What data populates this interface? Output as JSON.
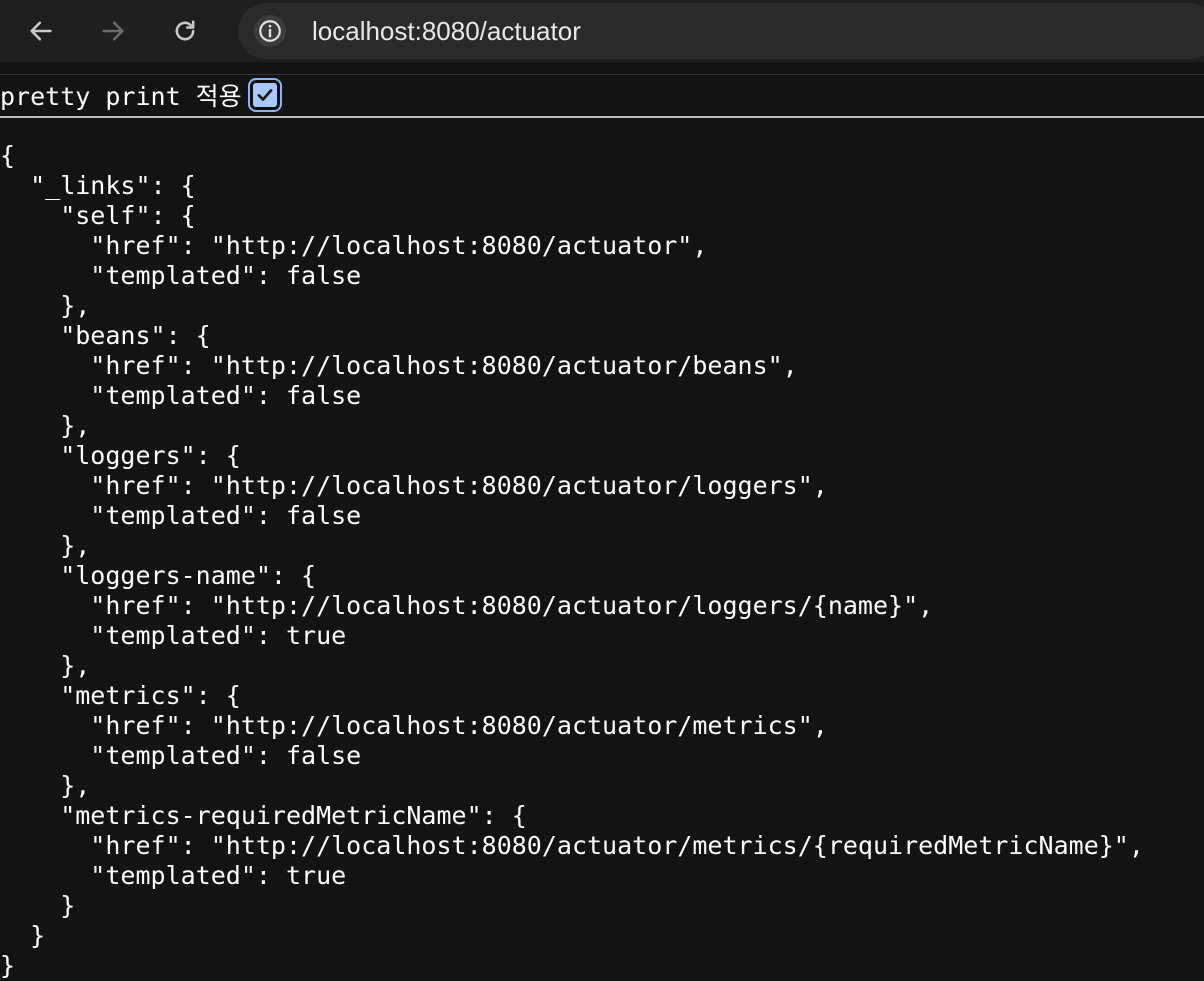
{
  "browser": {
    "url": "localhost:8080/actuator",
    "back_icon": "arrow-left-icon",
    "forward_icon": "arrow-right-icon",
    "reload_icon": "reload-icon",
    "site_info_icon": "info-circle-icon"
  },
  "pretty_print": {
    "label": "pretty print 적용",
    "checked": true
  },
  "json_lines": [
    "{",
    "  \"_links\": {",
    "    \"self\": {",
    "      \"href\": \"http://localhost:8080/actuator\",",
    "      \"templated\": false",
    "    },",
    "    \"beans\": {",
    "      \"href\": \"http://localhost:8080/actuator/beans\",",
    "      \"templated\": false",
    "    },",
    "    \"loggers\": {",
    "      \"href\": \"http://localhost:8080/actuator/loggers\",",
    "      \"templated\": false",
    "    },",
    "    \"loggers-name\": {",
    "      \"href\": \"http://localhost:8080/actuator/loggers/{name}\",",
    "      \"templated\": true",
    "    },",
    "    \"metrics\": {",
    "      \"href\": \"http://localhost:8080/actuator/metrics\",",
    "      \"templated\": false",
    "    },",
    "    \"metrics-requiredMetricName\": {",
    "      \"href\": \"http://localhost:8080/actuator/metrics/{requiredMetricName}\",",
    "      \"templated\": true",
    "    }",
    "  }",
    "}"
  ],
  "colors": {
    "page_background": "#131313",
    "text": "#ffffff",
    "checkbox_accent": "#a8c7fa"
  }
}
